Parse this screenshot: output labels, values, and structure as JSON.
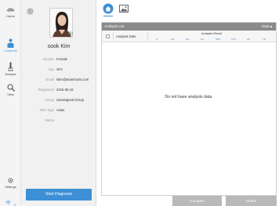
{
  "nav": {
    "items": [
      {
        "label": "Home",
        "icon": "home-icon"
      },
      {
        "label": "Customer",
        "icon": "customer-icon"
      },
      {
        "label": "Analyze",
        "icon": "analyze-icon"
      },
      {
        "label": "View",
        "icon": "view-icon"
      }
    ],
    "settings_label": "Settings",
    "status_text": "0",
    "active_color": "#3d8fd6"
  },
  "profile": {
    "name": "sook Kim",
    "fields": [
      {
        "key": "Gender",
        "value": "Female"
      },
      {
        "key": "Age",
        "value": "40's"
      },
      {
        "key": "Email",
        "value": "skim@aramhuvis.com"
      },
      {
        "key": "Registered",
        "value": "2015-05-15"
      },
      {
        "key": "Group",
        "value": "Unassigned Group"
      },
      {
        "key": "Skin Type",
        "value": "Asian"
      },
      {
        "key": "Memo",
        "value": ""
      }
    ],
    "start_button": "Start Diagnosis"
  },
  "main": {
    "tabs": [
      {
        "name": "tab-home",
        "icon": "house-icon"
      },
      {
        "name": "tab-photos",
        "icon": "image-icon"
      }
    ],
    "list": {
      "title": "Analysis List",
      "sort_label": "Date▲",
      "col_date": "Analysis Date",
      "result_header": "Analysis Result",
      "metrics": [
        "H",
        "AR",
        "SE",
        "KS",
        "SBV",
        "UVS",
        "HP",
        "TR"
      ],
      "empty_message": "Do not have analysis data."
    },
    "buttons": {
      "compare": "Compare",
      "delete": "Delete"
    }
  }
}
